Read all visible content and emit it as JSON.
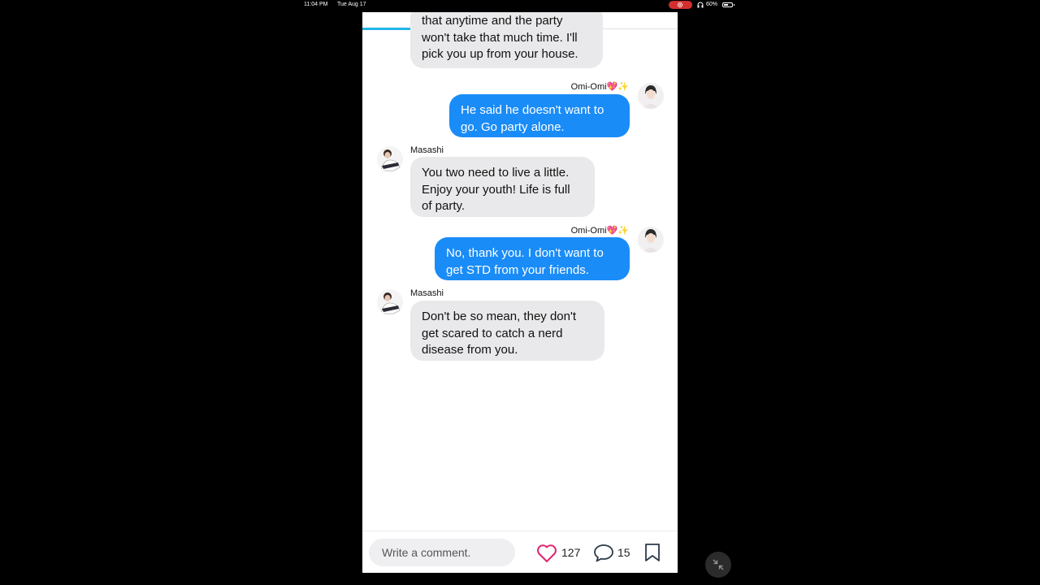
{
  "status_bar": {
    "time": "11:04 PM",
    "date": "Tue Aug 17",
    "battery_percent": "60%",
    "battery_level": 0.6,
    "recording_color": "#d32f2f"
  },
  "story": {
    "progress": 0.28,
    "messages": [
      {
        "side": "in",
        "text": "that anytime and the party\nwon't take that much time. I'll\npick you up from your house."
      },
      {
        "side": "out",
        "sender": "Omi-Omi💖✨",
        "text": "He said he doesn't want to\ngo. Go party alone."
      },
      {
        "side": "in",
        "sender": "Masashi",
        "text": "You two need to live a little.\nEnjoy your youth! Life is full\nof party."
      },
      {
        "side": "out",
        "sender": "Omi-Omi💖✨",
        "text": "No, thank you. I don't want to\nget STD from your friends."
      },
      {
        "side": "in",
        "sender": "Masashi",
        "text": "Don't be so mean, they don't\nget scared to catch a nerd\ndisease from you."
      }
    ]
  },
  "bottom_bar": {
    "comment_placeholder": "Write a comment.",
    "likes": "127",
    "comments": "15",
    "heart_color": "#e0246f",
    "accent_color": "#1a8cf7"
  },
  "icons": [
    "record-icon",
    "headphones-icon",
    "battery-icon",
    "heart-icon",
    "comment-icon",
    "bookmark-icon",
    "collapse-icon"
  ]
}
